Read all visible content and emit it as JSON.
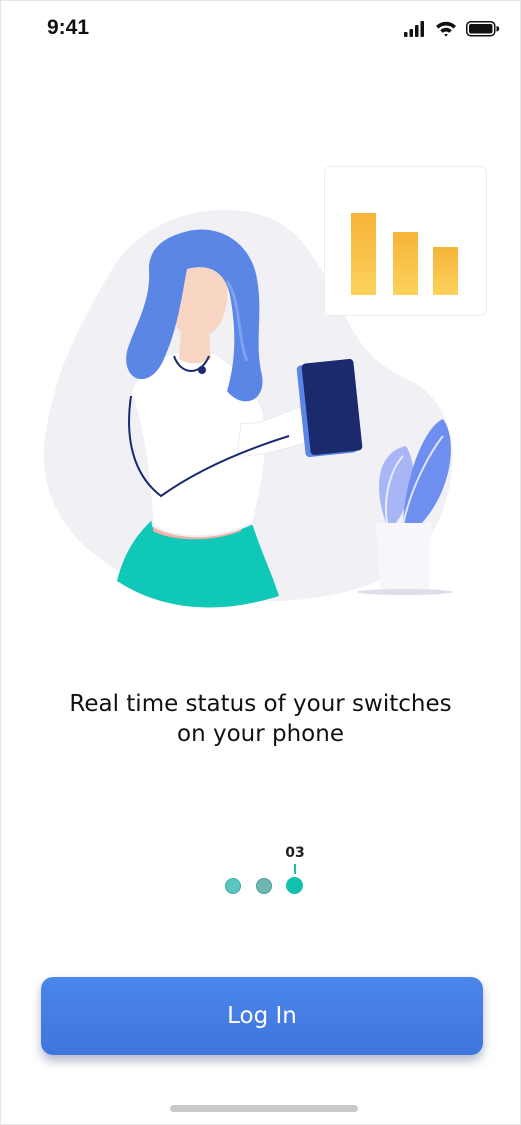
{
  "status_bar": {
    "time": "9:41",
    "icons": [
      "cellular-signal-icon",
      "wifi-icon",
      "battery-icon"
    ]
  },
  "illustration": {
    "name": "woman-holding-tablet-illustration",
    "chart_card_bars": [
      "bar-tall",
      "bar-medium",
      "bar-short"
    ],
    "colors": {
      "blob": "#f1f1f5",
      "hair": "#5b86e5",
      "skirt": "#0fc8b8",
      "tablet": "#1a2a6c",
      "bars": "#f6b93b",
      "leaves": "#6f8ff0"
    }
  },
  "onboarding": {
    "caption_line1": "Real time status of your switches",
    "caption_line2": "on your phone"
  },
  "pager": {
    "current_page_label": "03",
    "total_dots": 3,
    "active_index": 3,
    "accent_color": "#13c2ad"
  },
  "actions": {
    "login_label": "Log In",
    "button_color": "#4a86ec"
  }
}
